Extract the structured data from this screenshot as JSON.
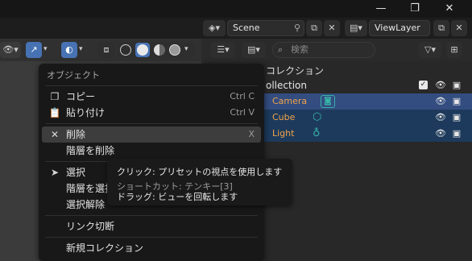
{
  "window": {
    "minimize_icon": "minimize-icon",
    "maximize_icon": "maximize-icon",
    "close_icon": "close-icon"
  },
  "topbar": {
    "scene_name": "Scene",
    "view_layer": "ViewLayer"
  },
  "outliner": {
    "header_title": "コレクション",
    "search_placeholder": "検索",
    "collection_label": "ollection",
    "rows": [
      {
        "name": "Camera"
      },
      {
        "name": "Cube"
      },
      {
        "name": "Light"
      }
    ]
  },
  "menu": {
    "title": "オブジェクト",
    "items": [
      {
        "label": "コピー",
        "shortcut": "Ctrl C"
      },
      {
        "label": "貼り付け",
        "shortcut": "Ctrl V"
      },
      {
        "label": "削除",
        "shortcut": "X"
      },
      {
        "label": "階層を削除"
      },
      {
        "label": "選択"
      },
      {
        "label": "階層を選択"
      },
      {
        "label": "選択解除"
      },
      {
        "label": "リンク切断"
      },
      {
        "label": "新規コレクション"
      }
    ]
  },
  "tooltip": {
    "line1": "クリック: プリセットの視点を使用します",
    "line2": "ショートカット: テンキー[3]",
    "line3": "ドラッグ: ビューを回転します"
  },
  "colors": {
    "selected_row": "#334d80",
    "orange_text": "#f0a34a",
    "teal_icon": "#37b3a8"
  }
}
